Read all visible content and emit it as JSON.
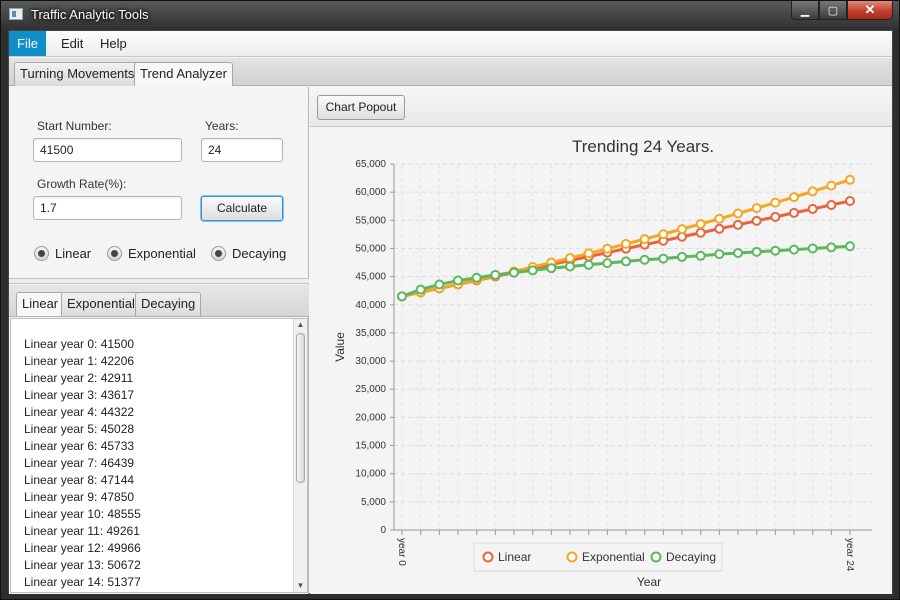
{
  "window": {
    "title": "Traffic Analytic Tools",
    "controls": {
      "minimize": "▁",
      "maximize": "▢",
      "close": "✕"
    }
  },
  "menu": [
    "File",
    "Edit",
    "Help"
  ],
  "top_tabs": [
    "Turning Movements",
    "Trend Analyzer"
  ],
  "form": {
    "start_label": "Start Number:",
    "start_value": "41500",
    "years_label": "Years:",
    "years_value": "24",
    "growth_label": "Growth Rate(%):",
    "growth_value": "1.7",
    "calculate_label": "Calculate",
    "radios": [
      "Linear",
      "Exponential",
      "Decaying"
    ]
  },
  "result_tabs": [
    "Linear",
    "Exponential",
    "Decaying"
  ],
  "result_lines": [
    "Linear year 0: 41500",
    "Linear year 1: 42206",
    "Linear year 2: 42911",
    "Linear year 3: 43617",
    "Linear year 4: 44322",
    "Linear year 5: 45028",
    "Linear year 6: 45733",
    "Linear year 7: 46439",
    "Linear year 8: 47144",
    "Linear year 9: 47850",
    "Linear year 10: 48555",
    "Linear year 11: 49261",
    "Linear year 12: 49966",
    "Linear year 13: 50672",
    "Linear year 14: 51377"
  ],
  "toolbar": {
    "popout_label": "Chart Popout"
  },
  "colors": {
    "linear": "#e8643c",
    "exponential": "#f5a623",
    "decaying": "#5cb85c",
    "accent": "#0f8ec7"
  },
  "chart_data": {
    "type": "line",
    "title": "Trending 24 Years.",
    "xlabel": "Year",
    "ylabel": "Value",
    "ylim": [
      0,
      65000
    ],
    "yticks": [
      0,
      5000,
      10000,
      15000,
      20000,
      25000,
      30000,
      35000,
      40000,
      45000,
      50000,
      55000,
      60000,
      65000
    ],
    "ytick_labels": [
      "0",
      "5,000",
      "10,000",
      "15,000",
      "20,000",
      "25,000",
      "30,000",
      "35,000",
      "40,000",
      "45,000",
      "50,000",
      "55,000",
      "60,000",
      "65,000"
    ],
    "x_tick_labels": {
      "0": "year 0",
      "24": "year 24"
    },
    "grid": true,
    "legend": "bottom",
    "x": [
      0,
      1,
      2,
      3,
      4,
      5,
      6,
      7,
      8,
      9,
      10,
      11,
      12,
      13,
      14,
      15,
      16,
      17,
      18,
      19,
      20,
      21,
      22,
      23,
      24
    ],
    "series": [
      {
        "name": "Linear",
        "values": [
          41500,
          42206,
          42911,
          43617,
          44322,
          45028,
          45733,
          46439,
          47144,
          47850,
          48555,
          49261,
          49966,
          50672,
          51377,
          52083,
          52788,
          53494,
          54199,
          54905,
          55610,
          56316,
          57021,
          57727,
          58432
        ]
      },
      {
        "name": "Exponential",
        "values": [
          41500,
          42206,
          42923,
          43653,
          44395,
          45150,
          45917,
          46698,
          47492,
          48299,
          49120,
          49955,
          50804,
          51668,
          52546,
          53440,
          54348,
          55272,
          56212,
          57167,
          58139,
          59127,
          60133,
          61155,
          62194
        ]
      },
      {
        "name": "Decaying",
        "values": [
          41500,
          42700,
          43600,
          44300,
          44800,
          45300,
          45700,
          46100,
          46500,
          46800,
          47100,
          47400,
          47700,
          48000,
          48200,
          48500,
          48700,
          49000,
          49200,
          49400,
          49600,
          49800,
          50000,
          50200,
          50400
        ]
      }
    ]
  }
}
